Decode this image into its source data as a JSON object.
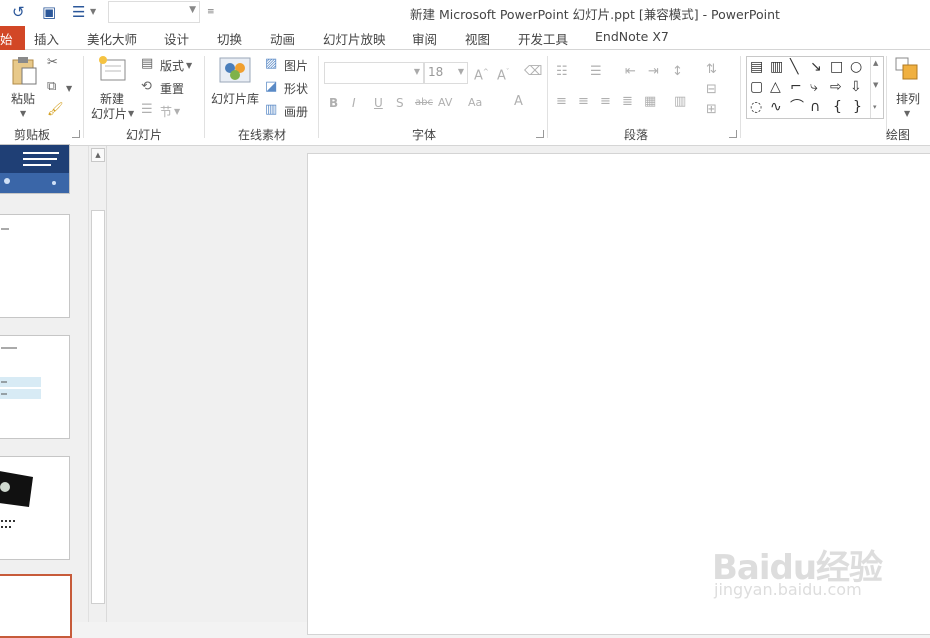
{
  "window": {
    "title": "新建 Microsoft PowerPoint 幻灯片.ppt [兼容模式] - PowerPoint"
  },
  "tabs": [
    "始",
    "插入",
    "美化大师",
    "设计",
    "切换",
    "动画",
    "幻灯片放映",
    "审阅",
    "视图",
    "开发工具",
    "EndNote X7"
  ],
  "ribbon": {
    "clipboard": {
      "paste": "粘贴",
      "label": "剪贴板"
    },
    "slides": {
      "new_line1": "新建",
      "new_line2": "幻灯片",
      "layout": "版式",
      "reset": "重置",
      "section": "节",
      "label": "幻灯片"
    },
    "online": {
      "library": "幻灯片库",
      "picture": "图片",
      "shape": "形状",
      "album": "画册",
      "label": "在线素材"
    },
    "font": {
      "size": "18",
      "label": "字体"
    },
    "paragraph": {
      "label": "段落"
    },
    "drawing": {
      "arrange": "排列",
      "label": "绘图"
    }
  },
  "watermark": {
    "brand": "Baidu经验",
    "site": "jingyan.baidu.com"
  }
}
